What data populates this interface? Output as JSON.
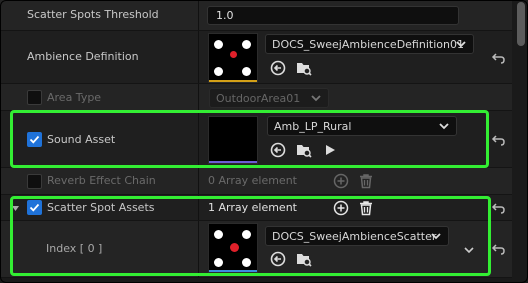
{
  "rows": {
    "scatter_threshold": {
      "label": "Scatter Spots Threshold",
      "value": "1.0"
    },
    "ambience_definition": {
      "label": "Ambience Definition",
      "asset": "DOCS_SweejAmbienceDefinition01"
    },
    "area_type": {
      "label": "Area Type",
      "value": "OutdoorArea01"
    },
    "sound_asset": {
      "label": "Sound Asset",
      "asset": "Amb_LP_Rural"
    },
    "reverb_chain": {
      "label": "Reverb Effect Chain",
      "value": "0 Array element"
    },
    "scatter_spot_assets": {
      "label": "Scatter Spot Assets",
      "value": "1 Array element"
    },
    "index0": {
      "label": "Index [ 0 ]",
      "asset": "DOCS_SweejAmbienceScatter"
    }
  },
  "colors": {
    "highlight": "#33ee33",
    "checkbox_on": "#1f72d9",
    "thumb_bar_ambience": "#d4a017",
    "thumb_bar_sound": "#6b5bd6",
    "thumb_bar_scatter": "#3a8de0",
    "dot_red": "#e0202a"
  },
  "icons": {
    "reset": "reset-arrow-icon",
    "browse": "use-selected-arrow-icon",
    "find": "browse-folder-icon",
    "play": "play-icon",
    "add": "add-circle-icon",
    "delete": "trash-icon",
    "chevron": "chevron-down-icon",
    "expand": "expand-triangle-icon",
    "check": "check-icon"
  }
}
